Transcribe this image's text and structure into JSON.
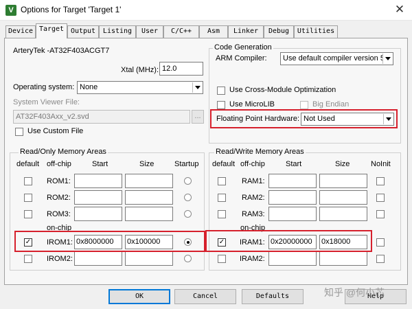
{
  "window": {
    "icon": "uvision-icon",
    "title": "Options for Target 'Target 1'",
    "close": "✕"
  },
  "tabs": [
    "Device",
    "Target",
    "Output",
    "Listing",
    "User",
    "C/C++",
    "Asm",
    "Linker",
    "Debug",
    "Utilities"
  ],
  "active_tab": "Target",
  "target": {
    "device_name": "ArteryTek -AT32F403ACGT7",
    "xtal_label": "Xtal (MHz):",
    "xtal_value": "12.0",
    "os_label": "Operating system:",
    "os_value": "None",
    "svd_label": "System Viewer File:",
    "svd_value": "AT32F403Axx_v2.svd",
    "svd_browse": "...",
    "custom_file_label": "Use Custom File"
  },
  "code_generation": {
    "title": "Code Generation",
    "compiler_label": "ARM Compiler:",
    "compiler_value": "Use default compiler version 5",
    "cross_module_label": "Use Cross-Module Optimization",
    "microlib_label": "Use MicroLIB",
    "big_endian_label": "Big Endian",
    "fph_label": "Floating Point Hardware:",
    "fph_value": "Not Used"
  },
  "ro_memory": {
    "title": "Read/Only Memory Areas",
    "headers": {
      "default": "default",
      "offchip": "off-chip",
      "start": "Start",
      "size": "Size",
      "startup": "Startup"
    },
    "onchip_label": "on-chip",
    "rows": [
      {
        "name": "ROM1:",
        "start": "",
        "size": "",
        "default": false,
        "startup": false
      },
      {
        "name": "ROM2:",
        "start": "",
        "size": "",
        "default": false,
        "startup": false
      },
      {
        "name": "ROM3:",
        "start": "",
        "size": "",
        "default": false,
        "startup": false
      },
      {
        "name": "IROM1:",
        "start": "0x8000000",
        "size": "0x100000",
        "default": true,
        "startup": true
      },
      {
        "name": "IROM2:",
        "start": "",
        "size": "",
        "default": false,
        "startup": false
      }
    ]
  },
  "rw_memory": {
    "title": "Read/Write Memory Areas",
    "headers": {
      "default": "default",
      "offchip": "off-chip",
      "start": "Start",
      "size": "Size",
      "noinit": "NoInit"
    },
    "onchip_label": "on-chip",
    "rows": [
      {
        "name": "RAM1:",
        "start": "",
        "size": "",
        "default": false,
        "noinit": false
      },
      {
        "name": "RAM2:",
        "start": "",
        "size": "",
        "default": false,
        "noinit": false
      },
      {
        "name": "RAM3:",
        "start": "",
        "size": "",
        "default": false,
        "noinit": false
      },
      {
        "name": "IRAM1:",
        "start": "0x20000000",
        "size": "0x18000",
        "default": true,
        "noinit": false
      },
      {
        "name": "IRAM2:",
        "start": "",
        "size": "",
        "default": false,
        "noinit": false
      }
    ]
  },
  "buttons": {
    "ok": "OK",
    "cancel": "Cancel",
    "defaults": "Defaults",
    "help": "Help"
  },
  "watermark": "知乎 @何小芯",
  "colors": {
    "highlight": "#d6202c",
    "dialog_bg": "#f0f0f0",
    "panel_bg": "#f7f7f7"
  }
}
